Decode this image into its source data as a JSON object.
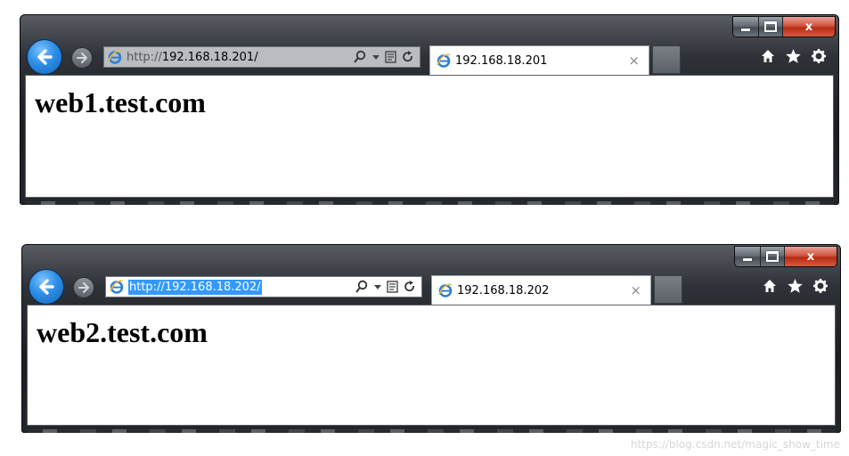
{
  "windows": [
    {
      "caption": {
        "close_label": "x"
      },
      "address": {
        "proto": "http://",
        "host": "192.168.18.201/",
        "full": "http://192.168.18.201/",
        "selected": false
      },
      "tab": {
        "title": "192.168.18.201",
        "close": "×"
      },
      "page": {
        "heading": "web1.test.com"
      }
    },
    {
      "caption": {
        "close_label": "x"
      },
      "address": {
        "proto": "http://",
        "host": "192.168.18.202/",
        "full": "http://192.168.18.202/",
        "selected": true
      },
      "tab": {
        "title": "192.168.18.202",
        "close": "×"
      },
      "page": {
        "heading": "web2.test.com"
      }
    }
  ],
  "watermark": "https://blog.csdn.net/magic_show_time",
  "colors": {
    "accent_blue": "#2d8ee6",
    "close_red": "#c8452a",
    "selection": "#3399ff",
    "frame_dark": "#1b1d21"
  }
}
